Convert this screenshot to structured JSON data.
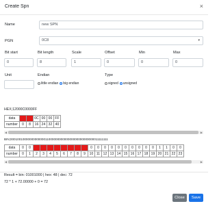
{
  "modal": {
    "title": "Create Spn",
    "close_icon": "×"
  },
  "form": {
    "name": {
      "label": "Name",
      "value": "new SPN"
    },
    "pgn": {
      "label": "PGN",
      "value": "0C8",
      "arrow": "▾"
    },
    "bit_start": {
      "label": "Bit start",
      "value": "0"
    },
    "bit_length": {
      "label": "Bit length",
      "value": "8"
    },
    "scale": {
      "label": "Scale",
      "value": "1"
    },
    "offset": {
      "label": "Offset",
      "value": "0"
    },
    "min": {
      "label": "Min",
      "value": "0"
    },
    "max": {
      "label": "Max",
      "value": "0"
    },
    "unit": {
      "label": "Unit",
      "value": ""
    },
    "endian": {
      "label": "Endian",
      "options": [
        "little endian",
        "big endian"
      ],
      "selected": "big endian"
    },
    "type": {
      "label": "Type",
      "options": [
        "signed",
        "unsigned"
      ],
      "selected": "unsigned"
    }
  },
  "hex": {
    "text": "HEX;12000C0000FF",
    "row_labels": [
      "data",
      "number"
    ],
    "data": [
      "",
      "",
      "0C",
      "00",
      "00",
      "FF"
    ],
    "numbers": [
      "0",
      "8",
      "16",
      "24",
      "32",
      "40"
    ],
    "red": [
      true,
      true,
      false,
      false,
      false,
      false
    ]
  },
  "bin": {
    "text": "BIN;000100100000000000001100000000000000000000000000011111111",
    "row_labels": [
      "data",
      "number"
    ],
    "data": [
      "0",
      "0",
      "",
      "",
      "",
      "",
      "",
      "",
      "",
      "",
      "0",
      "0",
      "0",
      "0",
      "0",
      "0",
      "0",
      "0",
      "0",
      "0",
      "1",
      "1",
      "0",
      "0"
    ],
    "numbers": [
      "0",
      "1",
      "2",
      "3",
      "4",
      "5",
      "6",
      "7",
      "8",
      "9",
      "10",
      "11",
      "12",
      "13",
      "14",
      "15",
      "16",
      "17",
      "18",
      "19",
      "20",
      "21",
      "22",
      "23"
    ],
    "red": [
      false,
      false,
      true,
      true,
      true,
      true,
      true,
      true,
      true,
      true,
      false,
      false,
      false,
      false,
      false,
      false,
      false,
      false,
      false,
      false,
      false,
      false,
      false,
      false
    ]
  },
  "result": {
    "line1": "Result = bin: 01001000 | hex: 48 | dec: 72",
    "line2": "72 * 1 + 72.00000 + 0 = 72"
  },
  "buttons": {
    "close": "Close",
    "save": "Save"
  },
  "colors": {
    "primary": "#1a73e8",
    "secondary": "#6c757d",
    "highlight": "#e41a1a"
  }
}
